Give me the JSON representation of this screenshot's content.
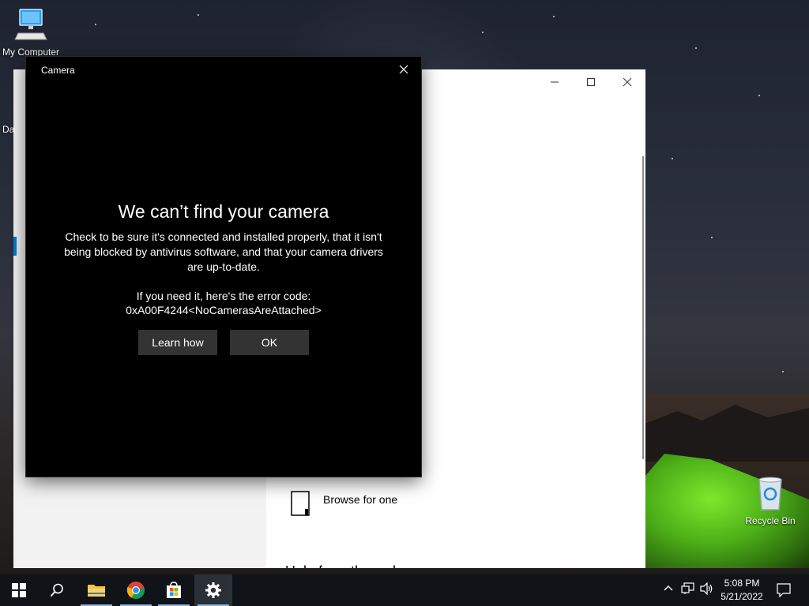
{
  "desktop": {
    "icons": [
      {
        "label": "My Computer"
      },
      {
        "label": "Recycle Bin"
      }
    ],
    "partial_label": "Da"
  },
  "background_window": {
    "browse_label": "Browse for one",
    "partial_heading": "Help from the web"
  },
  "dialog": {
    "title": "Camera",
    "heading": "We can’t find your camera",
    "message": "Check to be sure it's connected and installed properly, that it isn't being blocked by antivirus software, and that your camera drivers are up-to-date.",
    "error_intro": "If you need it, here's the error code:",
    "error_code": "0xA00F4244<NoCamerasAreAttached>",
    "buttons": {
      "learn_how": "Learn how",
      "ok": "OK"
    }
  },
  "taskbar": {
    "items": [
      "start-icon",
      "search-icon",
      "file-explorer-icon",
      "chrome-icon",
      "store-icon",
      "settings-icon"
    ],
    "active_item": "settings-icon",
    "clock": {
      "time": "5:08 PM",
      "date": "5/21/2022"
    }
  }
}
